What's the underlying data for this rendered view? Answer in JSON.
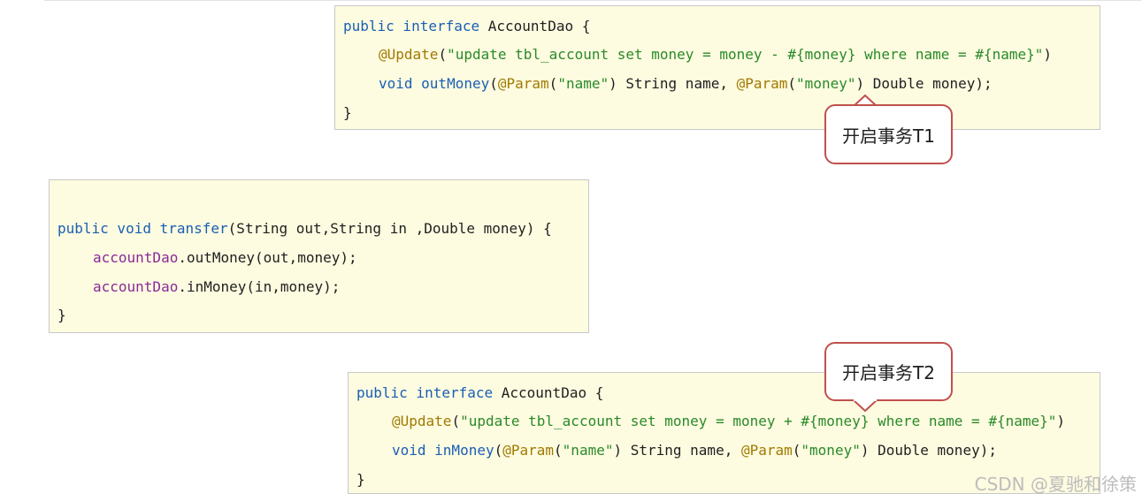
{
  "box1": {
    "l1": {
      "kw": "public interface",
      "name": " AccountDao {"
    },
    "l2": {
      "ann": "@Update",
      "p1": "(",
      "str": "\"update tbl_account set money = money - #{money} where name = #{name}\"",
      "p2": ")"
    },
    "l3": {
      "kw": "void",
      "fn": " outMoney",
      "p1": "(",
      "ann1": "@Param",
      "p2": "(",
      "str1": "\"name\"",
      "p3": ") String name, ",
      "ann2": "@Param",
      "p4": "(",
      "str2": "\"money\"",
      "p5": ") Double money);"
    },
    "l4": "}"
  },
  "box2": {
    "l1": {
      "kw": "public void",
      "fn": " transfer",
      "rest": "(String out,String in ,Double money) {"
    },
    "l2": {
      "fld": "accountDao",
      "rest": ".outMoney(out,money);"
    },
    "l3": {
      "fld": "accountDao",
      "rest": ".inMoney(in,money);"
    },
    "l4": "}"
  },
  "box3": {
    "l1": {
      "kw": "public interface",
      "name": " AccountDao {"
    },
    "l2": {
      "ann": "@Update",
      "p1": "(",
      "str": "\"update tbl_account set money = money + #{money} where name = #{name}\"",
      "p2": ")"
    },
    "l3": {
      "kw": "void",
      "fn": " inMoney",
      "p1": "(",
      "ann1": "@Param",
      "p2": "(",
      "str1": "\"name\"",
      "p3": ") String name, ",
      "ann2": "@Param",
      "p4": "(",
      "str2": "\"money\"",
      "p5": ") Double money);"
    },
    "l4": "}"
  },
  "callouts": {
    "t1": "开启事务T1",
    "t2": "开启事务T2"
  },
  "watermark": "CSDN @夏驰和徐策"
}
